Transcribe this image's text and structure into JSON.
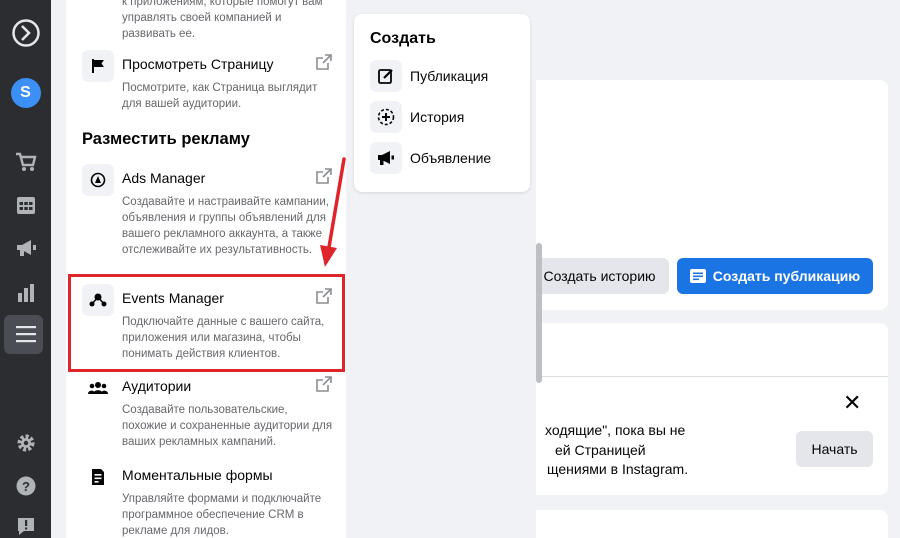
{
  "nav_rail": {
    "icons": [
      "logo-icon",
      "avatar",
      "shop-icon",
      "calendar-icon",
      "megaphone-icon",
      "chart-icon",
      "menu-icon",
      "gear-icon",
      "help-icon",
      "report-icon"
    ],
    "avatar_letter": "S"
  },
  "menu": {
    "top_item_desc": "к приложениям, которые помогут вам управлять своей компанией и развивать ее.",
    "view_page": {
      "title": "Просмотреть Страницу",
      "desc": "Посмотрите, как Страница выглядит для вашей аудитории."
    },
    "ads_section_heading": "Разместить рекламу",
    "ads_manager": {
      "title": "Ads Manager",
      "desc": "Создавайте и настраивайте кампании, объявления и группы объявлений для вашего рекламного аккаунта, а также отслеживайте их результативность."
    },
    "events_manager": {
      "title": "Events Manager",
      "desc": "Подключайте данные с вашего сайта, приложения или магазина, чтобы понимать действия клиентов."
    },
    "audiences": {
      "title": "Аудитории",
      "desc": "Создавайте пользовательские, похожие и сохраненные аудитории для ваших рекламных кампаний."
    },
    "instant_forms": {
      "title": "Моментальные формы",
      "desc": "Управляйте формами и подключайте программное обеспечение CRM в рекламе для лидов."
    }
  },
  "create_menu": {
    "heading": "Создать",
    "items": [
      "Публикация",
      "История",
      "Объявление"
    ]
  },
  "background": {
    "create_story_label": "Создать историю",
    "create_post_label": "Создать публикацию",
    "notice_line1": "ходящие\", пока вы не",
    "notice_line2": "ей Страницей",
    "notice_line3": "щениями в Instagram.",
    "start_label": "Начать"
  },
  "colors": {
    "accent": "#1b74e4",
    "highlight": "#e0242b",
    "rail": "#2b2d31"
  }
}
